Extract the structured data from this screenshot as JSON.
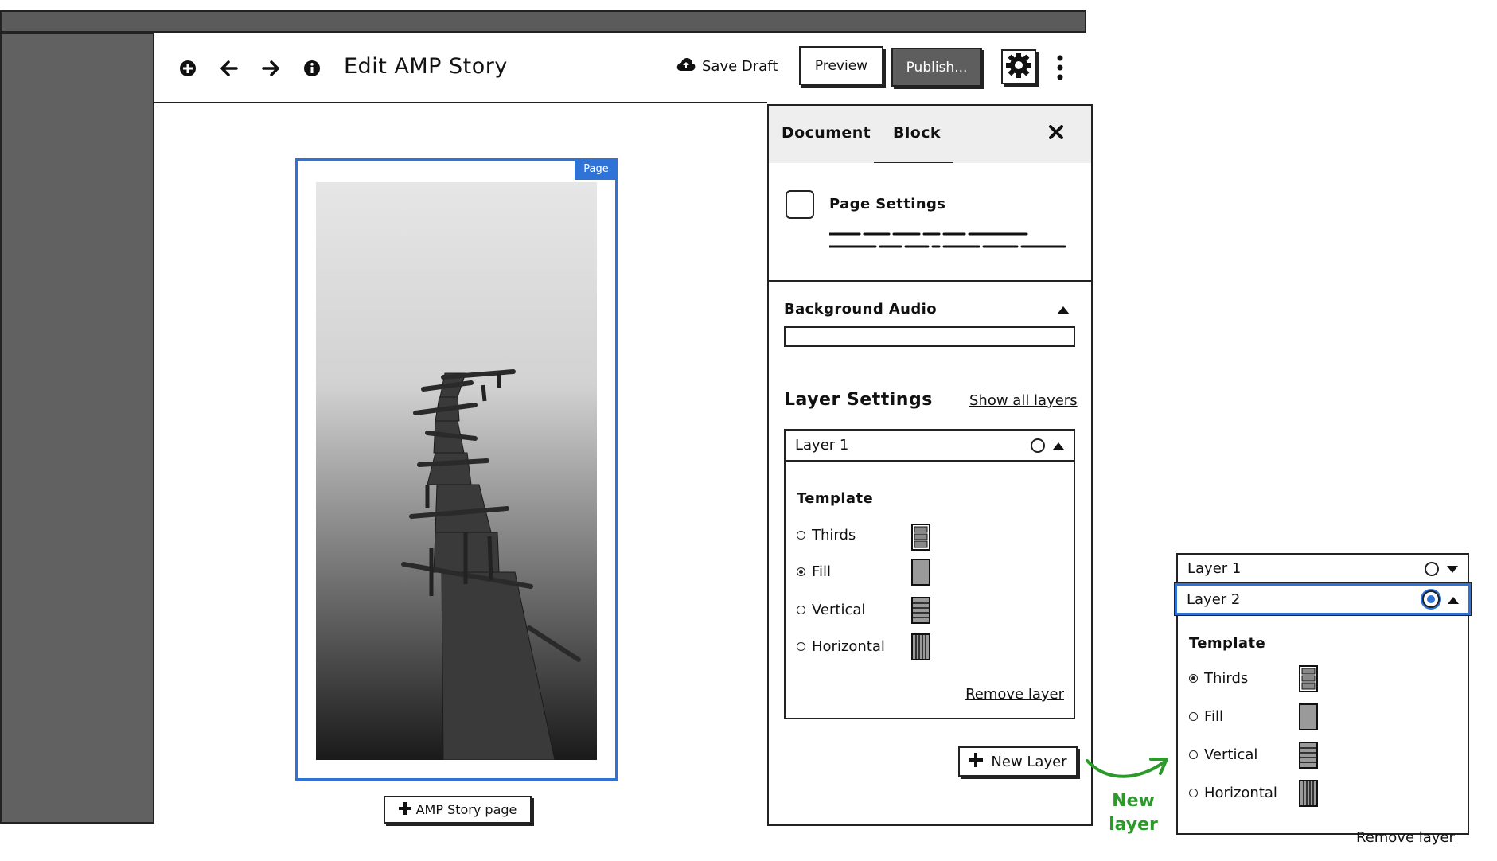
{
  "toolbar": {
    "title": "Edit AMP Story",
    "save_draft": "Save Draft",
    "preview": "Preview",
    "publish": "Publish..."
  },
  "canvas": {
    "page_tag": "Page",
    "add_page": "AMP Story page"
  },
  "sidebar": {
    "tabs": [
      "Document",
      "Block"
    ],
    "active_tab": "Block",
    "page_settings": {
      "title": "Page Settings"
    },
    "background_audio": {
      "title": "Background Audio",
      "value": ""
    },
    "layer_settings": {
      "title": "Layer Settings",
      "show_all": "Show all layers",
      "layer1": {
        "name": "Layer 1",
        "template_title": "Template",
        "options": [
          "Thirds",
          "Fill",
          "Vertical",
          "Horizontal"
        ],
        "selected": "Fill",
        "remove": "Remove layer"
      }
    },
    "new_layer": "New Layer"
  },
  "annotation": {
    "note_line1": "New",
    "note_line2": "layer",
    "color": "#2b9a2b"
  },
  "callout": {
    "layer1": "Layer 1",
    "layer2": "Layer 2",
    "template_title": "Template",
    "options": [
      "Thirds",
      "Fill",
      "Vertical",
      "Horizontal"
    ],
    "selected": "Thirds",
    "remove": "Remove layer"
  },
  "colors": {
    "accent": "#2f73d6",
    "chrome_dark": "#5b5b5b",
    "publish_bg": "#5e5e5e"
  }
}
